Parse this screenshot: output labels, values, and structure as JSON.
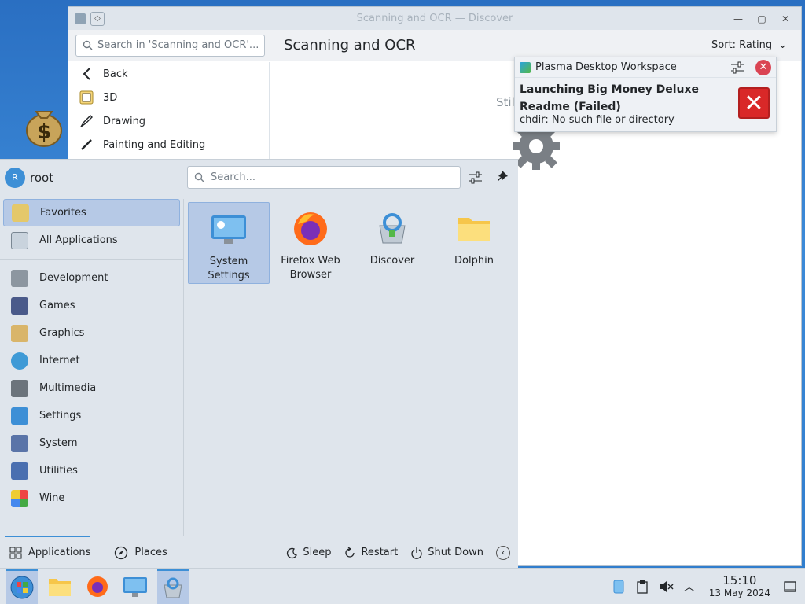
{
  "desktop": {
    "icon_name": "money-bag-icon"
  },
  "discover": {
    "window_title": "Scanning and OCR — Discover",
    "search_placeholder": "Search in 'Scanning and OCR'...",
    "page_title": "Scanning and OCR",
    "sort_label": "Sort: Rating",
    "sidebar": [
      {
        "label": "Back",
        "icon": "back-arrow-icon"
      },
      {
        "label": "3D",
        "icon": "3d-icon"
      },
      {
        "label": "Drawing",
        "icon": "drawing-icon"
      },
      {
        "label": "Painting and Editing",
        "icon": "brush-icon"
      }
    ],
    "still_text": "Still"
  },
  "notification": {
    "app_name": "Plasma Desktop Workspace",
    "title": "Launching Big Money Deluxe Readme (Failed)",
    "body": "chdir: No such file or directory"
  },
  "menu": {
    "user_initial": "R",
    "user_name": "root",
    "search_placeholder": "Search...",
    "categories": [
      {
        "label": "Favorites",
        "selected": true
      },
      {
        "label": "All Applications"
      },
      {
        "label": "Development"
      },
      {
        "label": "Games"
      },
      {
        "label": "Graphics"
      },
      {
        "label": "Internet"
      },
      {
        "label": "Multimedia"
      },
      {
        "label": "Settings"
      },
      {
        "label": "System"
      },
      {
        "label": "Utilities"
      },
      {
        "label": "Wine"
      }
    ],
    "apps": [
      {
        "label": "System Settings",
        "selected": true
      },
      {
        "label": "Firefox Web Browser"
      },
      {
        "label": "Discover"
      },
      {
        "label": "Dolphin"
      }
    ],
    "bottom": {
      "applications": "Applications",
      "places": "Places",
      "sleep": "Sleep",
      "restart": "Restart",
      "shutdown": "Shut Down"
    }
  },
  "taskbar": {
    "time": "15:10",
    "date": "13 May 2024"
  }
}
